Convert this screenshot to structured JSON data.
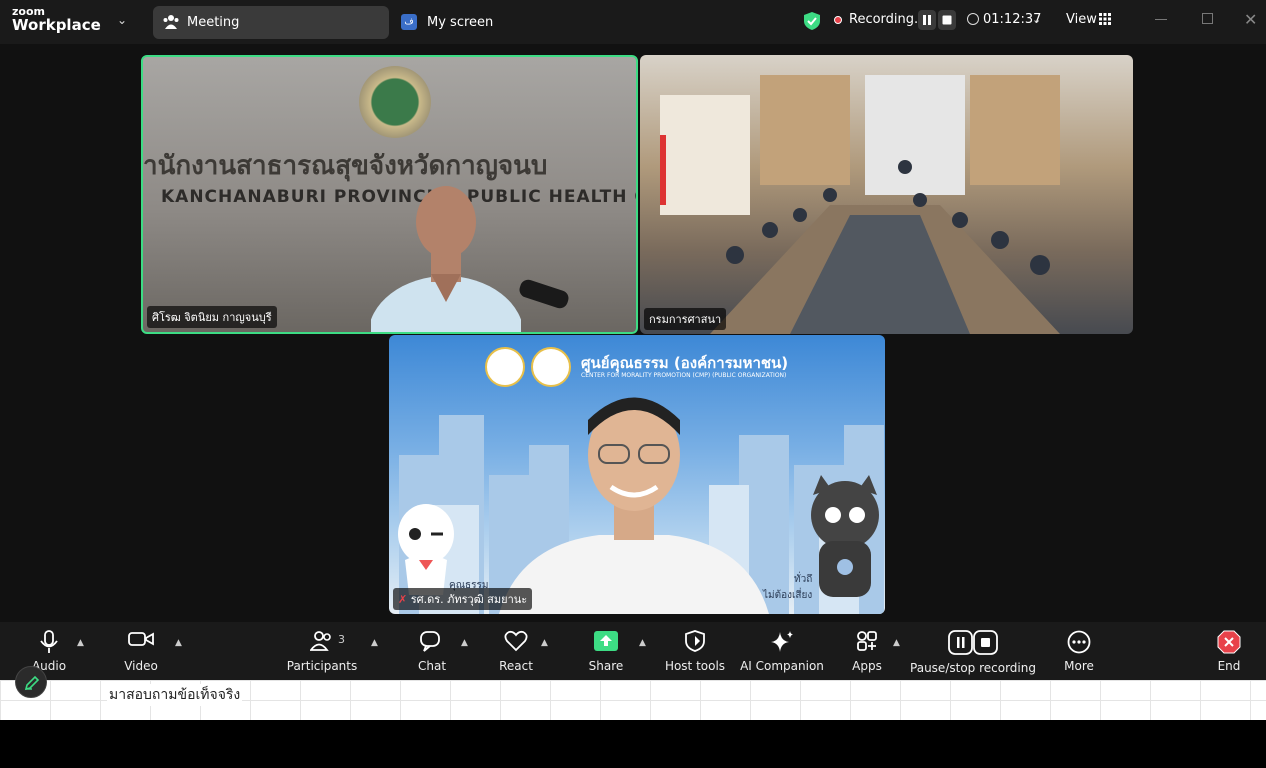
{
  "app": {
    "logo_line1": "zoom",
    "logo_line2": "Workplace"
  },
  "tabs": [
    {
      "label": "Meeting",
      "icon": "people-icon"
    },
    {
      "label": "My screen",
      "icon": "screen-share-icon"
    }
  ],
  "recording": {
    "label": "Recording...",
    "elapsed": "01:12:37"
  },
  "view": {
    "label": "View"
  },
  "colors": {
    "active_speaker": "#3ddc84",
    "toolbar_bg": "#1a1a1a",
    "share_green": "#3ddc84",
    "end_red": "#e8424a"
  },
  "participants_tiles": [
    {
      "name": "ศิโรฒ จิตนิยม กาญจนบุรี",
      "sign_th": "านักงานสาธารณสุขจังหวัดกาญจนบ",
      "sign_en": "KANCHANABURI PROVINCIAL PUBLIC HEALTH OFFICE",
      "active_speaker": true
    },
    {
      "name": "กรมการศาสนา"
    },
    {
      "name": "รศ.ดร. ภัทรวุฒิ สมยานะ",
      "muted": true,
      "bg_title": "ศูนย์คุณธรรม (องค์การมหาชน)",
      "bg_subtitle": "CENTER FOR MORALITY PROMOTION (CMP) (PUBLIC ORGANIZATION)",
      "mascot_left_caption": "คุณธรรม",
      "mascot_right_caption_1": "ทั่วถึ",
      "mascot_right_caption_2": "ไม่ต้องเสี่ยง"
    }
  ],
  "toolbar": {
    "audio": "Audio",
    "video": "Video",
    "participants": "Participants",
    "participants_count": "3",
    "chat": "Chat",
    "react": "React",
    "share": "Share",
    "host_tools": "Host tools",
    "ai_companion": "AI Companion",
    "apps": "Apps",
    "pause_stop_recording": "Pause/stop recording",
    "more": "More",
    "end": "End"
  },
  "document": {
    "line": "มาสอบถามข้อเท็จจริง"
  }
}
